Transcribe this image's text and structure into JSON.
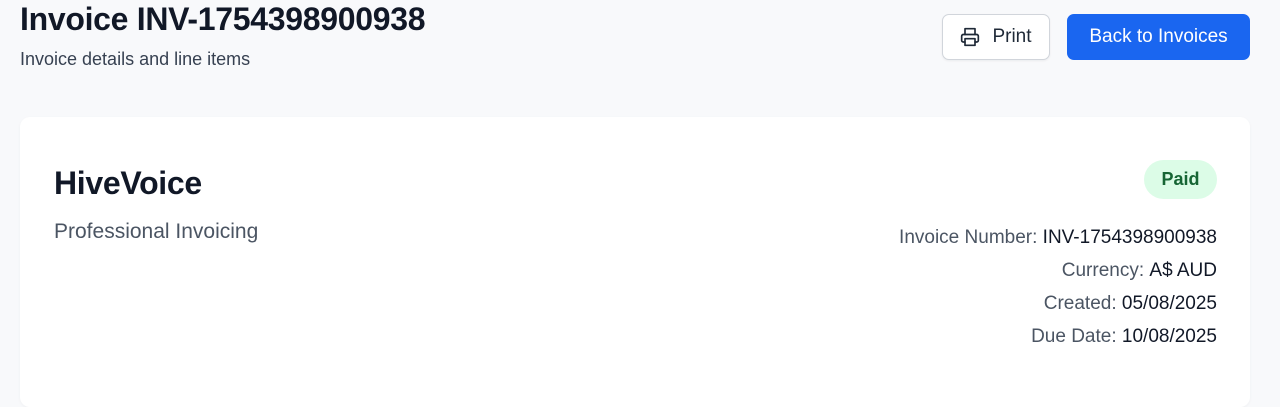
{
  "header": {
    "title": "Invoice INV-1754398900938",
    "subtitle": "Invoice details and line items",
    "print_label": "Print",
    "back_label": "Back to Invoices"
  },
  "invoice": {
    "brand_name": "HiveVoice",
    "brand_tagline": "Professional Invoicing",
    "status": "Paid",
    "meta": [
      {
        "label": "Invoice Number:",
        "value": "INV-1754398900938"
      },
      {
        "label": "Currency:",
        "value": "A$ AUD"
      },
      {
        "label": "Created:",
        "value": "05/08/2025"
      },
      {
        "label": "Due Date:",
        "value": "10/08/2025"
      }
    ]
  },
  "colors": {
    "primary": "#1a66f0",
    "background": "#f8f9fb",
    "status_paid_bg": "#dcfce7",
    "status_paid_text": "#166534"
  },
  "icons": {
    "print": "printer-icon"
  }
}
